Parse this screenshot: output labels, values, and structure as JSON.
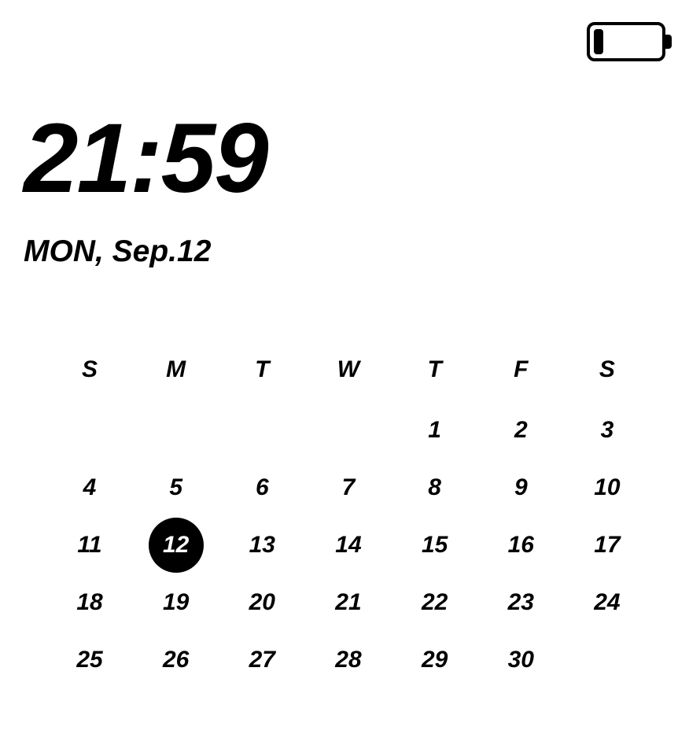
{
  "battery": {
    "level_percent": 12
  },
  "clock": {
    "time": "21:59"
  },
  "date": {
    "label": "MON, Sep.12"
  },
  "calendar": {
    "day_headers": [
      "S",
      "M",
      "T",
      "W",
      "T",
      "F",
      "S"
    ],
    "today": 12,
    "weeks": [
      [
        "",
        "",
        "",
        "",
        "1",
        "2",
        "3"
      ],
      [
        "4",
        "5",
        "6",
        "7",
        "8",
        "9",
        "10"
      ],
      [
        "11",
        "12",
        "13",
        "14",
        "15",
        "16",
        "17"
      ],
      [
        "18",
        "19",
        "20",
        "21",
        "22",
        "23",
        "24"
      ],
      [
        "25",
        "26",
        "27",
        "28",
        "29",
        "30",
        ""
      ]
    ]
  }
}
